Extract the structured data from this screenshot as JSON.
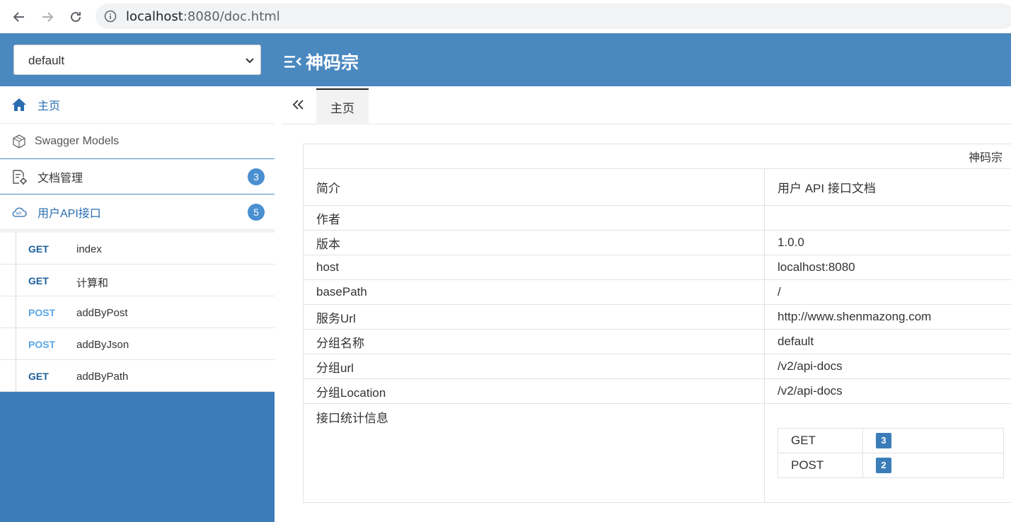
{
  "browser": {
    "url_host": "localhost",
    "url_rest": ":8080/doc.html"
  },
  "header": {
    "group_select_value": "default",
    "title": "神码宗"
  },
  "sidebar": {
    "home_label": "主页",
    "models_label": "Swagger Models",
    "docs_label": "文档管理",
    "docs_count": "3",
    "api_group_label": "用户API接口",
    "api_group_count": "5",
    "apis": [
      {
        "method": "GET",
        "name": "index"
      },
      {
        "method": "GET",
        "name": "计算和"
      },
      {
        "method": "POST",
        "name": "addByPost"
      },
      {
        "method": "POST",
        "name": "addByJson"
      },
      {
        "method": "GET",
        "name": "addByPath"
      }
    ]
  },
  "tabs": {
    "home_label": "主页"
  },
  "info": {
    "title": "神码宗",
    "rows": [
      {
        "key": "简介",
        "value": "用户 API 接口文档"
      },
      {
        "key": "作者",
        "value": ""
      },
      {
        "key": "版本",
        "value": "1.0.0"
      },
      {
        "key": "host",
        "value": "localhost:8080"
      },
      {
        "key": "basePath",
        "value": "/"
      },
      {
        "key": "服务Url",
        "value": "http://www.shenmazong.com"
      },
      {
        "key": "分组名称",
        "value": "default"
      },
      {
        "key": "分组url",
        "value": "/v2/api-docs"
      },
      {
        "key": "分组Location",
        "value": "/v2/api-docs"
      }
    ],
    "stats_label": "接口统计信息",
    "stats": [
      {
        "method": "GET",
        "count": "3"
      },
      {
        "method": "POST",
        "count": "2"
      }
    ]
  },
  "colors": {
    "header_bg": "#4a88c0",
    "sidebar_bg": "#3a7db8",
    "get_method": "#1d5f9c",
    "post_method": "#5aa7e8",
    "badge": "#4a8fd0"
  }
}
